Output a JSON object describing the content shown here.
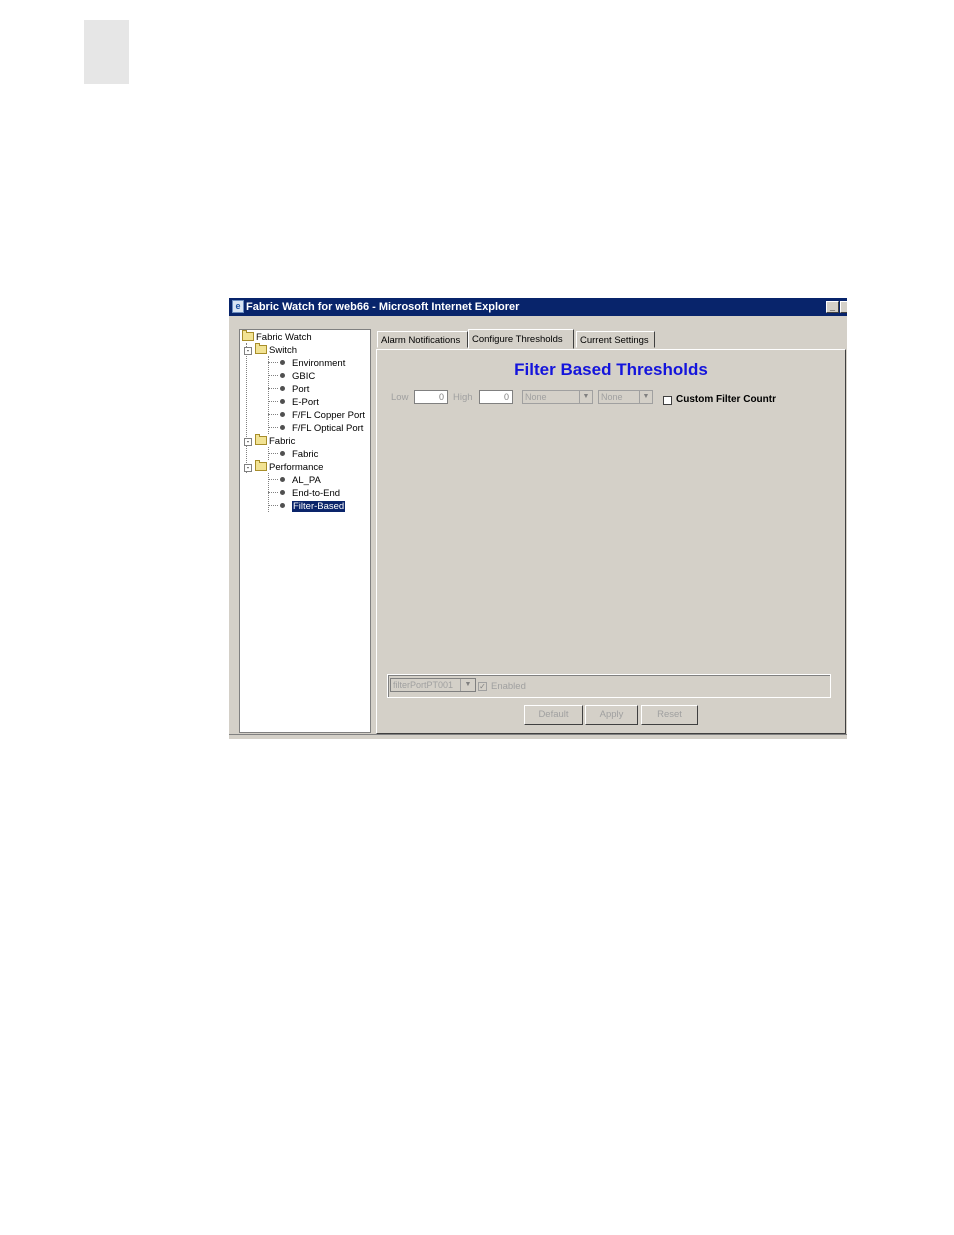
{
  "window": {
    "title": "Fabric Watch for web66 - Microsoft Internet Explorer",
    "minimize": "_"
  },
  "tree": {
    "root": "Fabric Watch",
    "switch": {
      "label": "Switch",
      "items": [
        "Environment",
        "GBIC",
        "Port",
        "E-Port",
        "F/FL Copper Port",
        "F/FL Optical Port"
      ]
    },
    "fabric": {
      "label": "Fabric",
      "items": [
        "Fabric"
      ]
    },
    "performance": {
      "label": "Performance",
      "items": [
        "AL_PA",
        "End-to-End",
        "Filter-Based"
      ]
    },
    "selected": "Filter-Based"
  },
  "tabs": [
    "Alarm Notifications",
    "Configure Thresholds",
    "Current Settings"
  ],
  "active_tab": "Configure Thresholds",
  "panel": {
    "heading": "Filter Based Thresholds",
    "low_label": "Low",
    "low_value": "0",
    "high_label": "High",
    "high_value": "0",
    "select1": "None",
    "select2": "None",
    "custom_checkbox_label": "Custom Filter Countr",
    "filter_select": "filterPortPT001",
    "enabled_label": "Enabled",
    "buttons": {
      "default": "Default",
      "apply": "Apply",
      "reset": "Reset"
    }
  }
}
